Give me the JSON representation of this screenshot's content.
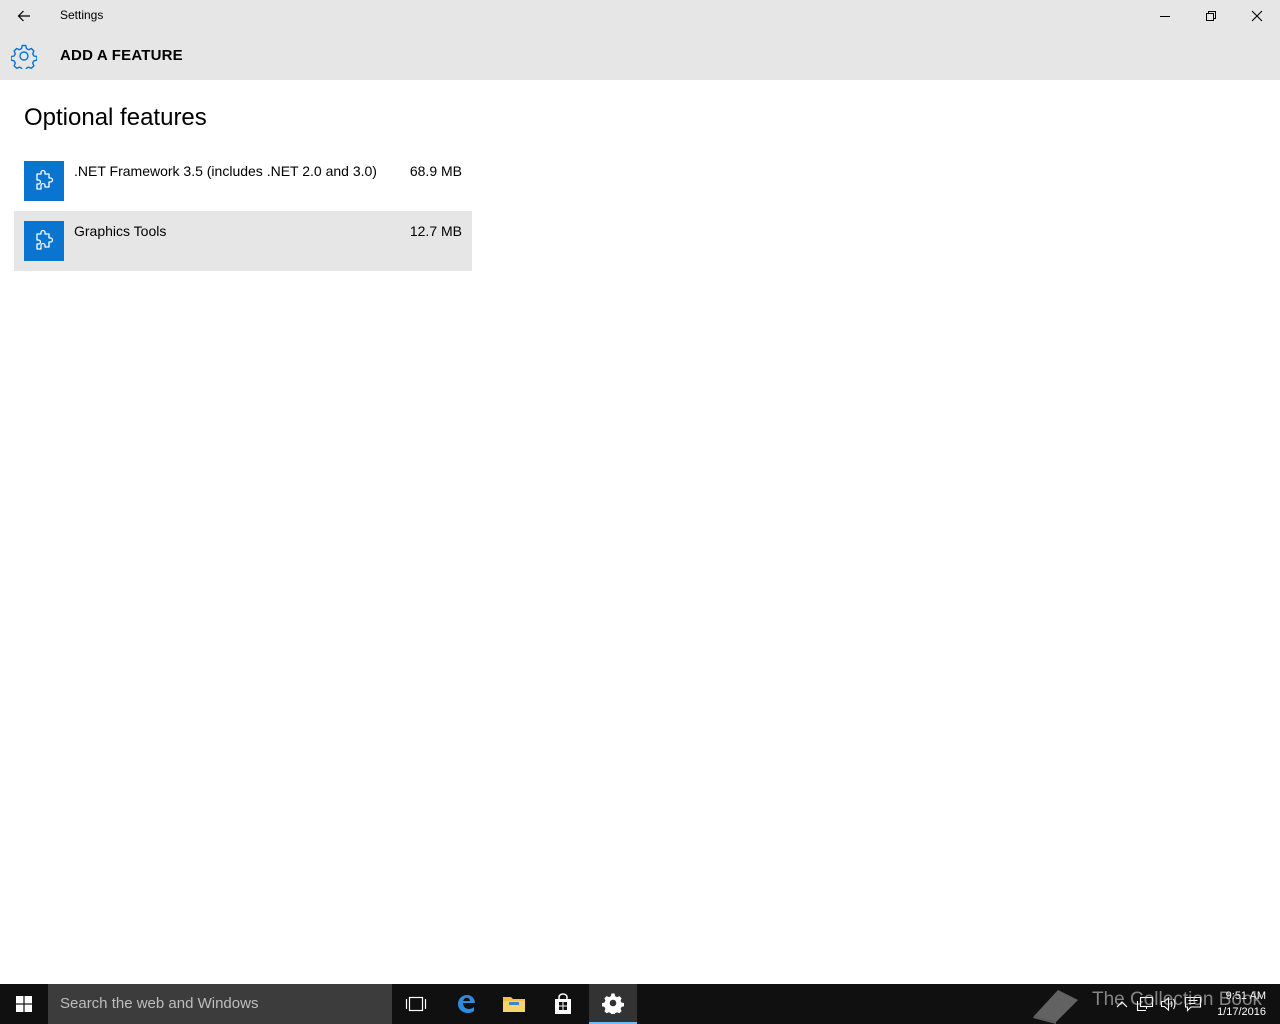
{
  "window": {
    "title": "Settings",
    "header_title": "ADD A FEATURE"
  },
  "page": {
    "heading": "Optional features"
  },
  "features": [
    {
      "name": ".NET Framework 3.5 (includes .NET 2.0 and 3.0)",
      "size": "68.9 MB",
      "icon": "puzzle-piece-icon",
      "selected": false
    },
    {
      "name": "Graphics Tools",
      "size": "12.7 MB",
      "icon": "puzzle-piece-icon",
      "selected": true
    }
  ],
  "taskbar": {
    "search_placeholder": "Search the web and Windows",
    "clock_time": "9:51 AM",
    "clock_date": "1/17/2016"
  },
  "watermark": {
    "text": "The Collection Book"
  },
  "colors": {
    "accent": "#0a74d1",
    "titlebar": "#e6e6e6",
    "taskbar": "#101010"
  }
}
